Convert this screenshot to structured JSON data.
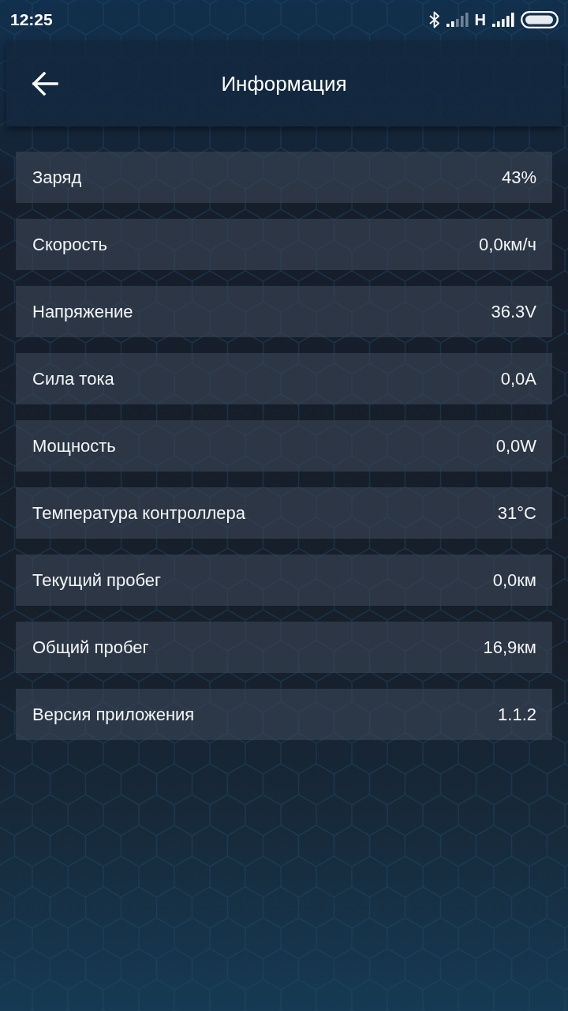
{
  "status_bar": {
    "time": "12:25",
    "network": "H"
  },
  "header": {
    "title": "Информация"
  },
  "rows": [
    {
      "label": "Заряд",
      "value": "43%"
    },
    {
      "label": "Скорость",
      "value": "0,0км/ч"
    },
    {
      "label": "Напряжение",
      "value": "36.3V"
    },
    {
      "label": "Сила тока",
      "value": "0,0A"
    },
    {
      "label": "Мощность",
      "value": "0,0W"
    },
    {
      "label": "Температура контроллера",
      "value": "31°C"
    },
    {
      "label": "Текущий пробег",
      "value": "0,0км"
    },
    {
      "label": "Общий пробег",
      "value": "16,9км"
    },
    {
      "label": "Версия приложения",
      "value": "1.1.2"
    }
  ]
}
